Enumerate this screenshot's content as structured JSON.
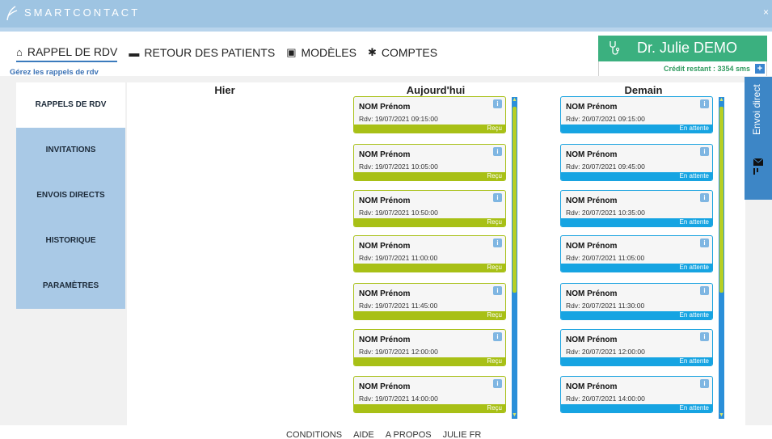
{
  "app": {
    "title": "SMARTCONTACT",
    "close_label": "×"
  },
  "nav": [
    {
      "label": "RAPPEL DE RDV",
      "icon": "home-icon",
      "glyph": "⌂"
    },
    {
      "label": "RETOUR DES PATIENTS",
      "icon": "feedback-icon",
      "glyph": "▬"
    },
    {
      "label": "MODÈLES",
      "icon": "calendar-icon",
      "glyph": "▣"
    },
    {
      "label": "COMPTES",
      "icon": "gear-icon",
      "glyph": "✱"
    }
  ],
  "subtitle": "Gérez les rappels de rdv",
  "doctor": {
    "name": "Dr. Julie DEMO",
    "credit": "Crédit restant : 3354 sms",
    "credit_add": "+"
  },
  "sidebar": {
    "items": [
      {
        "label": "RAPPELS DE RDV",
        "active": true
      },
      {
        "label": "INVITATIONS",
        "active": false
      },
      {
        "label": "ENVOIS DIRECTS",
        "active": false
      },
      {
        "label": "HISTORIQUE",
        "active": false
      },
      {
        "label": "PARAMÈTRES",
        "active": false
      }
    ]
  },
  "columns": {
    "hier": {
      "title": "Hier"
    },
    "aujourdhui": {
      "title": "Aujourd'hui",
      "cards": [
        {
          "name": "NOM Prénom",
          "rdv": "Rdv: 19/07/2021 09:15:00",
          "status": "Reçu",
          "info": "i"
        },
        {
          "name": "NOM Prénom",
          "rdv": "Rdv: 19/07/2021 10:05:00",
          "status": "Reçu",
          "info": "i"
        },
        {
          "name": "NOM Prénom",
          "rdv": "Rdv: 19/07/2021 10:50:00",
          "status": "Reçu",
          "info": "i"
        },
        {
          "name": "NOM Prénom",
          "rdv": "Rdv: 19/07/2021 11:00:00",
          "status": "Reçu",
          "info": "i"
        },
        {
          "name": "NOM Prénom",
          "rdv": "Rdv: 19/07/2021 11:45:00",
          "status": "Reçu",
          "info": "i"
        },
        {
          "name": "NOM Prénom",
          "rdv": "Rdv: 19/07/2021 12:00:00",
          "status": "Reçu",
          "info": "i"
        },
        {
          "name": "NOM Prénom",
          "rdv": "Rdv: 19/07/2021 14:00:00",
          "status": "Reçu",
          "info": "i"
        }
      ]
    },
    "demain": {
      "title": "Demain",
      "cards": [
        {
          "name": "NOM Prénom",
          "rdv": "Rdv: 20/07/2021 09:15:00",
          "status": "En attente",
          "info": "i"
        },
        {
          "name": "NOM Prénom",
          "rdv": "Rdv: 20/07/2021 09:45:00",
          "status": "En attente",
          "info": "i"
        },
        {
          "name": "NOM Prénom",
          "rdv": "Rdv: 20/07/2021 10:35:00",
          "status": "En attente",
          "info": "i"
        },
        {
          "name": "NOM Prénom",
          "rdv": "Rdv: 20/07/2021 11:05:00",
          "status": "En attente",
          "info": "i"
        },
        {
          "name": "NOM Prénom",
          "rdv": "Rdv: 20/07/2021 11:30:00",
          "status": "En attente",
          "info": "i"
        },
        {
          "name": "NOM Prénom",
          "rdv": "Rdv: 20/07/2021 12:00:00",
          "status": "En attente",
          "info": "i"
        },
        {
          "name": "NOM Prénom",
          "rdv": "Rdv: 20/07/2021 14:00:00",
          "status": "En attente",
          "info": "i"
        }
      ]
    }
  },
  "envoi_direct": {
    "label": "Envoi direct",
    "icon": "send-icon"
  },
  "footer": {
    "links": [
      "CONDITIONS",
      "AIDE",
      "A PROPOS",
      "JULIE FR"
    ]
  },
  "colors": {
    "titlebar": "#9ec4e2",
    "sidebar": "#a9c9e6",
    "doctor_box": "#3bb07f",
    "status_recu": "#a8c016",
    "status_attente": "#16a4e2",
    "envoi": "#3d86c6"
  }
}
